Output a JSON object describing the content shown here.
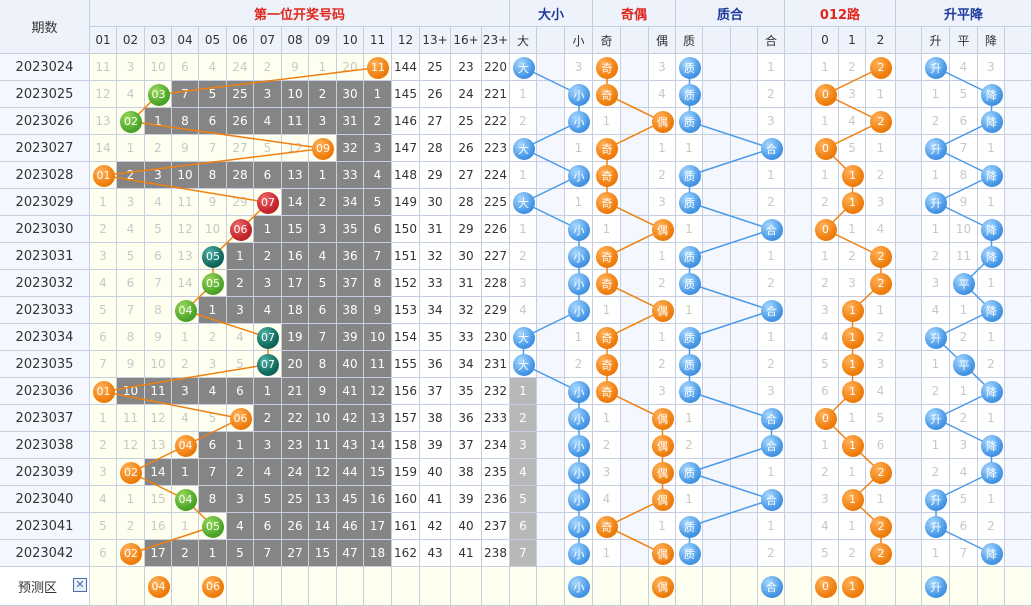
{
  "header": {
    "period_label": "期数",
    "main_title": "第一位开奖号码",
    "sections": [
      "大小",
      "奇偶",
      "质合",
      "012路",
      "升平降"
    ]
  },
  "number_headers": [
    "01",
    "02",
    "03",
    "04",
    "05",
    "06",
    "07",
    "08",
    "09",
    "10",
    "11",
    "12",
    "13+",
    "16+",
    "23+"
  ],
  "size_headers": [
    "大",
    "小"
  ],
  "parity_headers": [
    "奇",
    "偶"
  ],
  "prime_headers": [
    "质",
    "合"
  ],
  "route_headers": [
    "0",
    "1",
    "2"
  ],
  "trend_headers": [
    "升",
    "平",
    "降"
  ],
  "rows": [
    {
      "period": "2023024",
      "num": 11,
      "nums": [
        "11",
        "3",
        "10",
        "6",
        "4",
        "24",
        "2",
        "9",
        "1",
        "20",
        "11",
        "144",
        "25",
        "23",
        "220"
      ],
      "size": [
        "大",
        "3"
      ],
      "parity": [
        "奇",
        "3"
      ],
      "prime": [
        "质",
        "1"
      ],
      "route": [
        "1",
        "2",
        "2"
      ],
      "trend": [
        "升",
        "4",
        "3"
      ]
    },
    {
      "period": "2023025",
      "num": 3,
      "nums": [
        "12",
        "4",
        "03",
        "7",
        "5",
        "25",
        "3",
        "10",
        "2",
        "30",
        "1",
        "145",
        "26",
        "24",
        "221"
      ],
      "size": [
        "1",
        "小"
      ],
      "parity": [
        "奇",
        "4"
      ],
      "prime": [
        "质",
        "2"
      ],
      "route": [
        "0",
        "3",
        "1"
      ],
      "trend": [
        "1",
        "5",
        "降"
      ]
    },
    {
      "period": "2023026",
      "num": 2,
      "nums": [
        "13",
        "02",
        "1",
        "8",
        "6",
        "26",
        "4",
        "11",
        "3",
        "31",
        "2",
        "146",
        "27",
        "25",
        "222"
      ],
      "size": [
        "2",
        "小"
      ],
      "parity": [
        "1",
        "偶"
      ],
      "prime": [
        "质",
        "3"
      ],
      "route": [
        "1",
        "4",
        "2"
      ],
      "trend": [
        "2",
        "6",
        "降"
      ]
    },
    {
      "period": "2023027",
      "num": 9,
      "nums": [
        "14",
        "1",
        "2",
        "9",
        "7",
        "27",
        "5",
        "12",
        "09",
        "32",
        "3",
        "147",
        "28",
        "26",
        "223"
      ],
      "size": [
        "大",
        "1"
      ],
      "parity": [
        "奇",
        "1"
      ],
      "prime": [
        "1",
        "合"
      ],
      "route": [
        "0",
        "5",
        "1"
      ],
      "trend": [
        "升",
        "7",
        "1"
      ]
    },
    {
      "period": "2023028",
      "num": 1,
      "nums": [
        "01",
        "2",
        "3",
        "10",
        "8",
        "28",
        "6",
        "13",
        "1",
        "33",
        "4",
        "148",
        "29",
        "27",
        "224"
      ],
      "size": [
        "1",
        "小"
      ],
      "parity": [
        "奇",
        "2"
      ],
      "prime": [
        "质",
        "1"
      ],
      "route": [
        "1",
        "1",
        "2"
      ],
      "trend": [
        "1",
        "8",
        "降"
      ]
    },
    {
      "period": "2023029",
      "num": 7,
      "nums": [
        "1",
        "3",
        "4",
        "11",
        "9",
        "29",
        "07",
        "14",
        "2",
        "34",
        "5",
        "149",
        "30",
        "28",
        "225"
      ],
      "size": [
        "大",
        "1"
      ],
      "parity": [
        "奇",
        "3"
      ],
      "prime": [
        "质",
        "2"
      ],
      "route": [
        "2",
        "1",
        "3"
      ],
      "trend": [
        "升",
        "9",
        "1"
      ]
    },
    {
      "period": "2023030",
      "num": 6,
      "nums": [
        "2",
        "4",
        "5",
        "12",
        "10",
        "06",
        "1",
        "15",
        "3",
        "35",
        "6",
        "150",
        "31",
        "29",
        "226"
      ],
      "size": [
        "1",
        "小"
      ],
      "parity": [
        "1",
        "偶"
      ],
      "prime": [
        "1",
        "合"
      ],
      "route": [
        "0",
        "1",
        "4"
      ],
      "trend": [
        "1",
        "10",
        "降"
      ]
    },
    {
      "period": "2023031",
      "num": 5,
      "nums": [
        "3",
        "5",
        "6",
        "13",
        "05",
        "1",
        "2",
        "16",
        "4",
        "36",
        "7",
        "151",
        "32",
        "30",
        "227"
      ],
      "size": [
        "2",
        "小"
      ],
      "parity": [
        "奇",
        "1"
      ],
      "prime": [
        "质",
        "1"
      ],
      "route": [
        "1",
        "2",
        "2"
      ],
      "trend": [
        "2",
        "11",
        "降"
      ]
    },
    {
      "period": "2023032",
      "num": 5,
      "nums": [
        "4",
        "6",
        "7",
        "14",
        "05",
        "2",
        "3",
        "17",
        "5",
        "37",
        "8",
        "152",
        "33",
        "31",
        "228"
      ],
      "size": [
        "3",
        "小"
      ],
      "parity": [
        "奇",
        "2"
      ],
      "prime": [
        "质",
        "2"
      ],
      "route": [
        "2",
        "3",
        "2"
      ],
      "trend": [
        "3",
        "平",
        "1"
      ]
    },
    {
      "period": "2023033",
      "num": 4,
      "nums": [
        "5",
        "7",
        "8",
        "04",
        "1",
        "3",
        "4",
        "18",
        "6",
        "38",
        "9",
        "153",
        "34",
        "32",
        "229"
      ],
      "size": [
        "4",
        "小"
      ],
      "parity": [
        "1",
        "偶"
      ],
      "prime": [
        "1",
        "合"
      ],
      "route": [
        "3",
        "1",
        "1"
      ],
      "trend": [
        "4",
        "1",
        "降"
      ]
    },
    {
      "period": "2023034",
      "num": 7,
      "nums": [
        "6",
        "8",
        "9",
        "1",
        "2",
        "4",
        "07",
        "19",
        "7",
        "39",
        "10",
        "154",
        "35",
        "33",
        "230"
      ],
      "size": [
        "大",
        "1"
      ],
      "parity": [
        "奇",
        "1"
      ],
      "prime": [
        "质",
        "1"
      ],
      "route": [
        "4",
        "1",
        "2"
      ],
      "trend": [
        "升",
        "2",
        "1"
      ]
    },
    {
      "period": "2023035",
      "num": 7,
      "nums": [
        "7",
        "9",
        "10",
        "2",
        "3",
        "5",
        "07",
        "20",
        "8",
        "40",
        "11",
        "155",
        "36",
        "34",
        "231"
      ],
      "size": [
        "大",
        "2"
      ],
      "parity": [
        "奇",
        "2"
      ],
      "prime": [
        "质",
        "2"
      ],
      "route": [
        "5",
        "1",
        "3"
      ],
      "trend": [
        "1",
        "平",
        "2"
      ]
    },
    {
      "period": "2023036",
      "num": 1,
      "nums": [
        "01",
        "10",
        "11",
        "3",
        "4",
        "6",
        "1",
        "21",
        "9",
        "41",
        "12",
        "156",
        "37",
        "35",
        "232"
      ],
      "size": [
        "1",
        "小"
      ],
      "parity": [
        "奇",
        "3"
      ],
      "prime": [
        "质",
        "3"
      ],
      "route": [
        "6",
        "1",
        "4"
      ],
      "trend": [
        "2",
        "1",
        "降"
      ]
    },
    {
      "period": "2023037",
      "num": 6,
      "nums": [
        "1",
        "11",
        "12",
        "4",
        "5",
        "06",
        "2",
        "22",
        "10",
        "42",
        "13",
        "157",
        "38",
        "36",
        "233"
      ],
      "size": [
        "2",
        "小"
      ],
      "parity": [
        "1",
        "偶"
      ],
      "prime": [
        "1",
        "合"
      ],
      "route": [
        "0",
        "1",
        "5"
      ],
      "trend": [
        "升",
        "2",
        "1"
      ]
    },
    {
      "period": "2023038",
      "num": 4,
      "nums": [
        "2",
        "12",
        "13",
        "04",
        "6",
        "1",
        "3",
        "23",
        "11",
        "43",
        "14",
        "158",
        "39",
        "37",
        "234"
      ],
      "size": [
        "3",
        "小"
      ],
      "parity": [
        "2",
        "偶"
      ],
      "prime": [
        "2",
        "合"
      ],
      "route": [
        "1",
        "1",
        "6"
      ],
      "trend": [
        "1",
        "3",
        "降"
      ]
    },
    {
      "period": "2023039",
      "num": 2,
      "nums": [
        "3",
        "02",
        "14",
        "1",
        "7",
        "2",
        "4",
        "24",
        "12",
        "44",
        "15",
        "159",
        "40",
        "38",
        "235"
      ],
      "size": [
        "4",
        "小"
      ],
      "parity": [
        "3",
        "偶"
      ],
      "prime": [
        "质",
        "1"
      ],
      "route": [
        "2",
        "1",
        "2"
      ],
      "trend": [
        "2",
        "4",
        "降"
      ]
    },
    {
      "period": "2023040",
      "num": 4,
      "nums": [
        "4",
        "1",
        "15",
        "04",
        "8",
        "3",
        "5",
        "25",
        "13",
        "45",
        "16",
        "160",
        "41",
        "39",
        "236"
      ],
      "size": [
        "5",
        "小"
      ],
      "parity": [
        "4",
        "偶"
      ],
      "prime": [
        "1",
        "合"
      ],
      "route": [
        "3",
        "1",
        "1"
      ],
      "trend": [
        "升",
        "5",
        "1"
      ]
    },
    {
      "period": "2023041",
      "num": 5,
      "nums": [
        "5",
        "2",
        "16",
        "1",
        "05",
        "4",
        "6",
        "26",
        "14",
        "46",
        "17",
        "161",
        "42",
        "40",
        "237"
      ],
      "size": [
        "6",
        "小"
      ],
      "parity": [
        "奇",
        "1"
      ],
      "prime": [
        "质",
        "1"
      ],
      "route": [
        "4",
        "1",
        "2"
      ],
      "trend": [
        "升",
        "6",
        "2"
      ]
    },
    {
      "period": "2023042",
      "num": 2,
      "nums": [
        "6",
        "02",
        "17",
        "2",
        "1",
        "5",
        "7",
        "27",
        "15",
        "47",
        "18",
        "162",
        "43",
        "41",
        "238"
      ],
      "size": [
        "7",
        "小"
      ],
      "parity": [
        "1",
        "偶"
      ],
      "prime": [
        "质",
        "2"
      ],
      "route": [
        "5",
        "2",
        "2"
      ],
      "trend": [
        "1",
        "7",
        "降"
      ]
    }
  ],
  "prediction": {
    "label": "预测区",
    "close_symbol": "✕",
    "balls": [
      {
        "col": 3,
        "text": "04"
      },
      {
        "col": 5,
        "text": "06"
      },
      {
        "col": 16,
        "text": "小"
      },
      {
        "col": 19,
        "text": "偶"
      },
      {
        "col": 21,
        "text": "合"
      },
      {
        "col": 22,
        "text": "0"
      },
      {
        "col": 23,
        "text": "1"
      },
      {
        "col": 25,
        "text": "升"
      }
    ]
  },
  "colors": {
    "orange": "#f08010",
    "green": "#4fa82a",
    "red": "#c4272c",
    "teal": "#0f6b5e",
    "blue": "#4a9ae8",
    "header_red": "#e0261d",
    "header_blue": "#1e3a9a"
  }
}
